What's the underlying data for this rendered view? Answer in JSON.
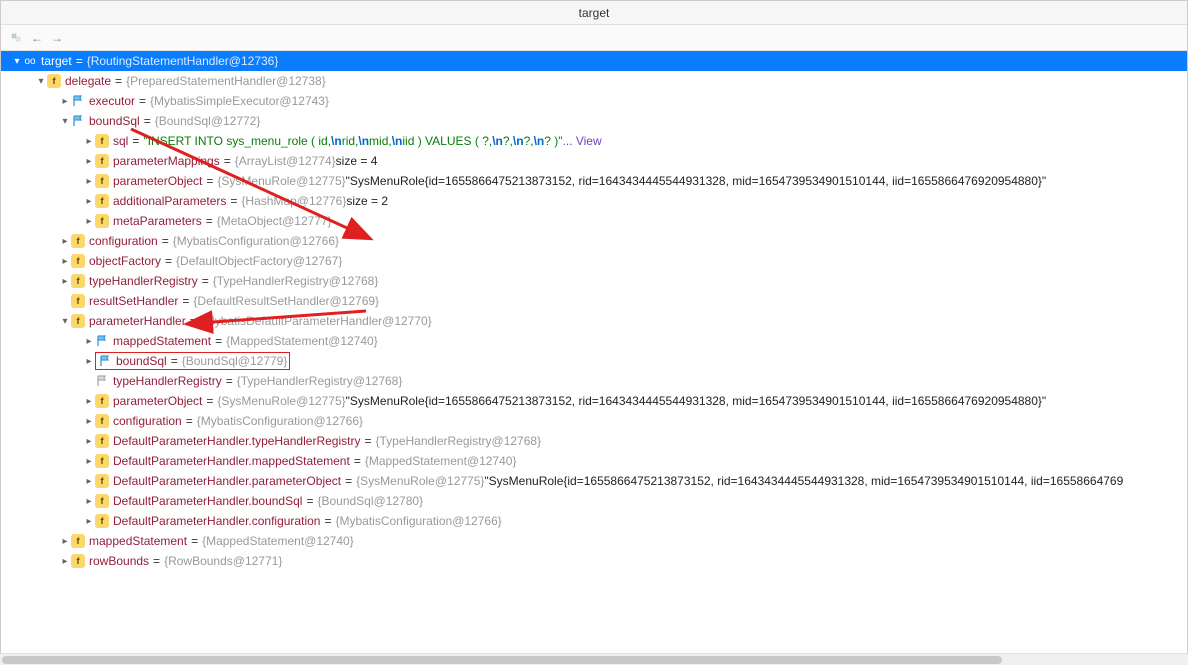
{
  "title": "target",
  "rows": [
    {
      "indent": 10,
      "arrow": "down",
      "icon": "oo",
      "name": "target",
      "eq": true,
      "val": "{RoutingStatementHandler@12736}",
      "valClass": "val-gray",
      "selected": true
    },
    {
      "indent": 34,
      "arrow": "down",
      "icon": "f",
      "name": "delegate",
      "eq": true,
      "val": "{PreparedStatementHandler@12738}",
      "valClass": "val-gray"
    },
    {
      "indent": 58,
      "arrow": "right",
      "icon": "flag",
      "name": "executor",
      "eq": true,
      "val": "{MybatisSimpleExecutor@12743}",
      "valClass": "val-gray"
    },
    {
      "indent": 58,
      "arrow": "down",
      "icon": "flag",
      "name": "boundSql",
      "eq": true,
      "val": "{BoundSql@12772}",
      "valClass": "val-gray"
    },
    {
      "indent": 82,
      "arrow": "right",
      "icon": "f",
      "name": "sql",
      "eq": true,
      "valHtml": "sql"
    },
    {
      "indent": 82,
      "arrow": "right",
      "icon": "f",
      "name": "parameterMappings",
      "eq": true,
      "val": "{ArrayList@12774}",
      "valClass": "val-gray",
      "suffix": "  size = 4"
    },
    {
      "indent": 82,
      "arrow": "right",
      "icon": "f",
      "name": "parameterObject",
      "eq": true,
      "val": "{SysMenuRole@12775}",
      "valClass": "val-gray",
      "suffix": " \"SysMenuRole{id=1655866475213873152, rid=1643434445544931328, mid=1654739534901510144, iid=1655866476920954880}\""
    },
    {
      "indent": 82,
      "arrow": "right",
      "icon": "f",
      "name": "additionalParameters",
      "eq": true,
      "val": "{HashMap@12776}",
      "valClass": "val-gray",
      "suffix": "  size = 2"
    },
    {
      "indent": 82,
      "arrow": "right",
      "icon": "f",
      "name": "metaParameters",
      "eq": true,
      "val": "{MetaObject@12777}",
      "valClass": "val-gray"
    },
    {
      "indent": 58,
      "arrow": "right",
      "icon": "f",
      "name": "configuration",
      "eq": true,
      "val": "{MybatisConfiguration@12766}",
      "valClass": "val-gray"
    },
    {
      "indent": 58,
      "arrow": "right",
      "icon": "f",
      "name": "objectFactory",
      "eq": true,
      "val": "{DefaultObjectFactory@12767}",
      "valClass": "val-gray"
    },
    {
      "indent": 58,
      "arrow": "right",
      "icon": "f",
      "name": "typeHandlerRegistry",
      "eq": true,
      "val": "{TypeHandlerRegistry@12768}",
      "valClass": "val-gray"
    },
    {
      "indent": 58,
      "arrow": "none",
      "icon": "f",
      "name": "resultSetHandler",
      "eq": true,
      "val": "{DefaultResultSetHandler@12769}",
      "valClass": "val-gray"
    },
    {
      "indent": 58,
      "arrow": "down",
      "icon": "f",
      "name": "parameterHandler",
      "eq": true,
      "val": "{MybatisDefaultParameterHandler@12770}",
      "valClass": "val-gray"
    },
    {
      "indent": 82,
      "arrow": "right",
      "icon": "flag",
      "name": "mappedStatement",
      "eq": true,
      "val": "{MappedStatement@12740}",
      "valClass": "val-gray"
    },
    {
      "indent": 82,
      "arrow": "right",
      "icon": "flag",
      "name": "boundSql",
      "eq": true,
      "val": "{BoundSql@12779}",
      "valClass": "val-gray",
      "boxed": true
    },
    {
      "indent": 82,
      "arrow": "none",
      "icon": "flag-gray",
      "name": "typeHandlerRegistry",
      "eq": true,
      "val": "{TypeHandlerRegistry@12768}",
      "valClass": "val-gray"
    },
    {
      "indent": 82,
      "arrow": "right",
      "icon": "f",
      "name": "parameterObject",
      "eq": true,
      "val": "{SysMenuRole@12775}",
      "valClass": "val-gray",
      "suffix": " \"SysMenuRole{id=1655866475213873152, rid=1643434445544931328, mid=1654739534901510144, iid=1655866476920954880}\""
    },
    {
      "indent": 82,
      "arrow": "right",
      "icon": "f",
      "name": "configuration",
      "eq": true,
      "val": "{MybatisConfiguration@12766}",
      "valClass": "val-gray"
    },
    {
      "indent": 82,
      "arrow": "right",
      "icon": "f",
      "name": "DefaultParameterHandler.typeHandlerRegistry",
      "eq": true,
      "val": "{TypeHandlerRegistry@12768}",
      "valClass": "val-gray"
    },
    {
      "indent": 82,
      "arrow": "right",
      "icon": "f",
      "name": "DefaultParameterHandler.mappedStatement",
      "eq": true,
      "val": "{MappedStatement@12740}",
      "valClass": "val-gray"
    },
    {
      "indent": 82,
      "arrow": "right",
      "icon": "f",
      "name": "DefaultParameterHandler.parameterObject",
      "eq": true,
      "val": "{SysMenuRole@12775}",
      "valClass": "val-gray",
      "suffix": " \"SysMenuRole{id=1655866475213873152, rid=1643434445544931328, mid=1654739534901510144, iid=16558664769"
    },
    {
      "indent": 82,
      "arrow": "right",
      "icon": "f",
      "name": "DefaultParameterHandler.boundSql",
      "eq": true,
      "val": "{BoundSql@12780}",
      "valClass": "val-gray"
    },
    {
      "indent": 82,
      "arrow": "right",
      "icon": "f",
      "name": "DefaultParameterHandler.configuration",
      "eq": true,
      "val": "{MybatisConfiguration@12766}",
      "valClass": "val-gray"
    },
    {
      "indent": 58,
      "arrow": "right",
      "icon": "f",
      "name": "mappedStatement",
      "eq": true,
      "val": "{MappedStatement@12740}",
      "valClass": "val-gray"
    },
    {
      "indent": 58,
      "arrow": "right",
      "icon": "f",
      "name": "rowBounds",
      "eq": true,
      "val": "{RowBounds@12771}",
      "valClass": "val-gray"
    }
  ],
  "sql_text": {
    "prefix": "\"I",
    "kw": "NSERT INTO",
    "t1": " sys_menu_role  ( id,",
    "nl": "\\n",
    "t2": "rid,",
    "t3": "mid,",
    "t4": "iid )  VALUES  ( ?,",
    "t5": "?,",
    "t6": "?,",
    "t7": "? )\"",
    "view": " ... View"
  }
}
